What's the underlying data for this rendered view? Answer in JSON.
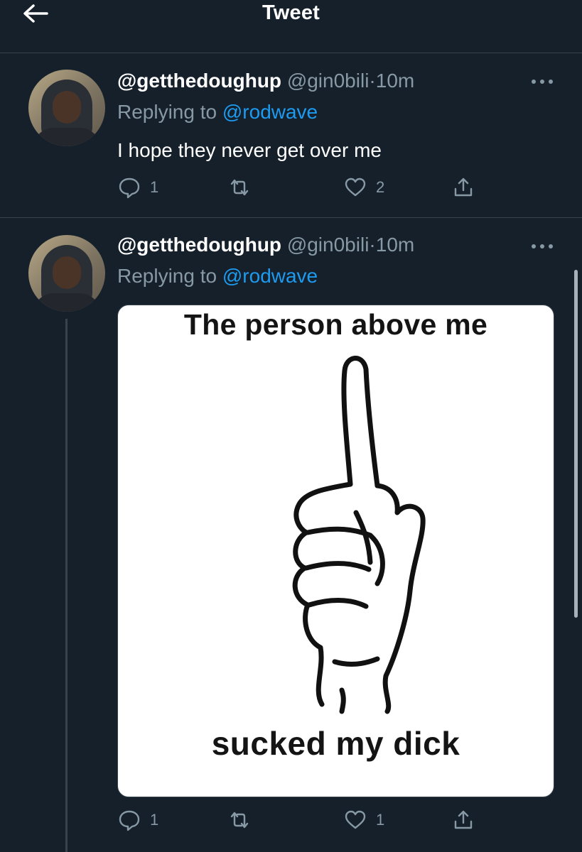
{
  "header": {
    "title": "Tweet",
    "back_icon": "arrow-left-icon"
  },
  "tweets": [
    {
      "name": "@getthedoughup",
      "handle": "@gin0bili",
      "separator": "·",
      "time": "10m",
      "replying_prefix": "Replying to",
      "replying_to": "@rodwave",
      "text": "I hope they never get over me",
      "replies": "1",
      "likes": "2"
    },
    {
      "name": "@getthedoughup",
      "handle": "@gin0bili",
      "separator": "·",
      "time": "10m",
      "replying_prefix": "Replying to",
      "replying_to": "@rodwave",
      "image_caption_top": "The person above me",
      "image_caption_bottom": "sucked my dick",
      "replies": "1",
      "likes": "1"
    }
  ],
  "colors": {
    "background": "#15202b",
    "accent": "#1d9bf0",
    "muted": "#8899a6",
    "divider": "#38444d"
  }
}
